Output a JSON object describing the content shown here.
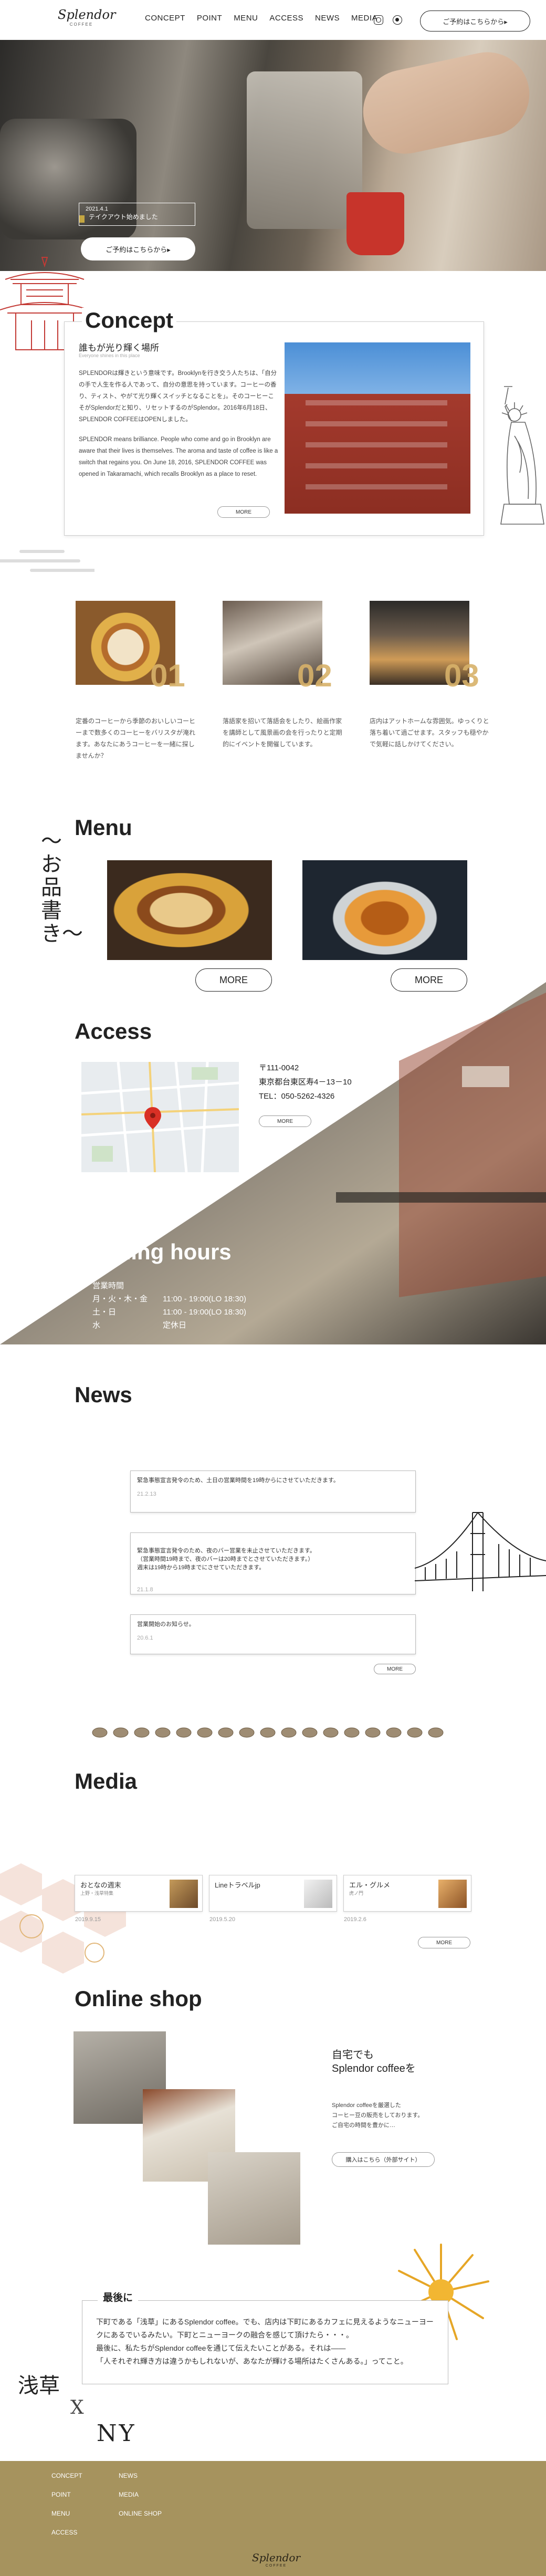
{
  "header": {
    "logo_text": "Splendor",
    "logo_sub": "COFFEE",
    "nav": [
      "CONCEPT",
      "POINT",
      "MENU",
      "ACCESS",
      "NEWS",
      "MEDIA"
    ],
    "reserve_label": "ご予約はこちらから▸"
  },
  "hero": {
    "news_date": "2021.4.1",
    "news_text": "テイクアウト始めました",
    "reserve_label": "ご予約はこちらから▸"
  },
  "concept": {
    "title": "Concept",
    "subtitle": "誰もが光り輝く場所",
    "subtitle_en": "Everyone shines in this place",
    "p1": "SPLENDORは輝きという意味です。Brooklynを行き交う人たちは、「自分の手で人生を作る人であって、自分の意思を持っています。コーヒーの香り、ティスト、やがて光り輝くスイッチとなることを」。そのコーヒーこそがSplendorだと知り、リセットするのがSplendor。2016年6月18日、SPLENDOR COFFEEはOPENしました。",
    "p2": "SPLENDOR means brilliance. People who come and go in Brooklyn are aware that their lives is themselves. The aroma and taste of coffee is like a switch that regains you. On June 18, 2016, SPLENDOR COFFEE was opened in Takaramachi, which recalls Brooklyn as a place to reset.",
    "more_label": "MORE"
  },
  "features": [
    {
      "num": "01",
      "text": "定番のコーヒーから季節のおいしいコーヒーまで数多くのコーヒーをバリスタが淹れます。あなたにあうコーヒーを一緒に探しませんか？"
    },
    {
      "num": "02",
      "text": "落語家を招いて落語会をしたり、絵画作家を講師として風景画の会を行ったりと定期的にイベントを開催しています。"
    },
    {
      "num": "03",
      "text": "店内はアットホームな雰囲気。ゆっくりと落ち着いて過ごせます。スタッフも穏やかで気軽に話しかけてください。"
    }
  ],
  "menu": {
    "title": "Menu",
    "vertical": "〜お品書き〜",
    "more_label": "MORE"
  },
  "access": {
    "title": "Access",
    "zip": "〒111-0042",
    "address": "東京都台東区寿4－13－10",
    "tel": "TEL：050-5262-4326",
    "more_label": "MORE"
  },
  "hours": {
    "title": "Opening hours",
    "heading": "営業時間",
    "rows": [
      {
        "day": "月・火・木・金",
        "time": "11:00 - 19:00(LO 18:30)"
      },
      {
        "day": "土・日",
        "time": "11:00 - 19:00(LO 18:30)"
      },
      {
        "day": "水",
        "time": "定休日"
      }
    ]
  },
  "news": {
    "title": "News",
    "items": [
      {
        "text": "緊急事態宣言発令のため、土日の営業時間を19時からにさせていただきます。",
        "date": "21.2.13"
      },
      {
        "text": "緊急事態宣言発令のため、夜のバー営業を未止させていただきます。\n（営業時間19時まで、夜のバーは20時までとさせていただきます。）\n週末は19時から19時までにさせていただきます。",
        "date": "21.1.8"
      },
      {
        "text": "営業開始のお知らせ。",
        "date": "20.6.1"
      }
    ],
    "more_label": "MORE"
  },
  "media": {
    "title": "Media",
    "items": [
      {
        "name": "おとなの週末",
        "sub": "上野・浅草特集",
        "date": "2019.9.15"
      },
      {
        "name": "Lineトラベルjp",
        "sub": "",
        "date": "2019.5.20"
      },
      {
        "name": "エル・グルメ",
        "sub": "虎ノ門",
        "date": "2019.2.6"
      }
    ],
    "more_label": "MORE"
  },
  "shop": {
    "title": "Online shop",
    "heading1": "自宅でも",
    "heading2": "Splendor coffeeを",
    "p1": "Splendor coffeeを厳選した",
    "p2": "コーヒー豆の販売をしております。",
    "p3": "ご自宅の時間を豊かに…",
    "button": "購入はこちら（外部サイト）"
  },
  "last": {
    "title": "最後に",
    "lines": [
      "下町である「浅草」にあるSplendor coffee。でも、店内は下町にあるカフェに見えるようなニューヨークにあるでいるみたい。下町とニューヨークの融合を感じて頂けたら・・・。",
      "最後に、私たちがSplendor coffeeを通じて伝えたいことがある。それは――",
      "「人それぞれ輝き方は違うかもしれないが、あなたが輝ける場所はたくさんある。」ってこと。"
    ],
    "asakusa": "浅草",
    "x": "X",
    "ny": "NY"
  },
  "footer": {
    "col1": [
      "CONCEPT",
      "POINT",
      "MENU",
      "ACCESS"
    ],
    "col2": [
      "NEWS",
      "MEDIA",
      "ONLINE SHOP"
    ],
    "logo_text": "Splendor",
    "logo_sub": "COFFEE"
  }
}
